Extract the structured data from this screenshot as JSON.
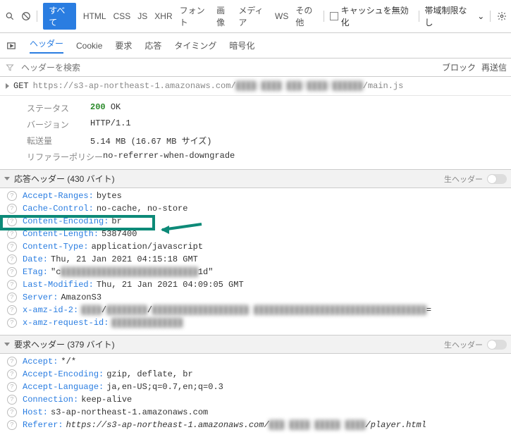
{
  "toolbar1": {
    "tabs": [
      "すべて",
      "HTML",
      "CSS",
      "JS",
      "XHR",
      "フォント",
      "画像",
      "メディア",
      "WS",
      "その他"
    ],
    "disableCache": "キャッシュを無効化",
    "throttling": "帯域制限なし"
  },
  "toolbar2": {
    "tabs": [
      "ヘッダー",
      "Cookie",
      "要求",
      "応答",
      "タイミング",
      "暗号化"
    ]
  },
  "toolbar3": {
    "searchPlaceholder": "ヘッダーを検索",
    "block": "ブロック",
    "resend": "再送信"
  },
  "request": {
    "method": "GET",
    "urlPrefix": "https://s3-ap-northeast-1.amazonaws.com/",
    "urlBlurred": "████-████ ███/████/██████",
    "urlSuffix": "/main.js"
  },
  "meta": {
    "statusLabel": "ステータス",
    "statusCode": "200",
    "statusText": "OK",
    "versionLabel": "バージョン",
    "version": "HTTP/1.1",
    "transferLabel": "転送量",
    "transfer": "5.14 MB (16.67 MB サイズ)",
    "referrerLabel": "リファラーポリシー",
    "referrer": "no-referrer-when-downgrade"
  },
  "response": {
    "sectionLabel": "応答ヘッダー (430 バイト)",
    "rawLabel": "生ヘッダー",
    "headers": [
      {
        "name": "Accept-Ranges",
        "value": "bytes"
      },
      {
        "name": "Cache-Control",
        "value": "no-cache, no-store"
      },
      {
        "name": "Content-Encoding",
        "value": "br"
      },
      {
        "name": "Content-Length",
        "value": "5387400"
      },
      {
        "name": "Content-Type",
        "value": "application/javascript"
      },
      {
        "name": "Date",
        "value": "Thu, 21 Jan 2021 04:15:18 GMT"
      },
      {
        "name": "ETag",
        "value": "\"c███████████████████████████1d\""
      },
      {
        "name": "Last-Modified",
        "value": "Thu, 21 Jan 2021 04:09:05 GMT"
      },
      {
        "name": "Server",
        "value": "AmazonS3"
      },
      {
        "name": "x-amz-id-2",
        "value": "████/████████/███████████████████ ██████████████████████████████████="
      },
      {
        "name": "x-amz-request-id",
        "value": "██████████████"
      }
    ]
  },
  "reqHeaders": {
    "sectionLabel": "要求ヘッダー (379 バイト)",
    "rawLabel": "生ヘッダー",
    "headers": [
      {
        "name": "Accept",
        "value": "*/*"
      },
      {
        "name": "Accept-Encoding",
        "value": "gzip, deflate, br"
      },
      {
        "name": "Accept-Language",
        "value": "ja,en-US;q=0.7,en;q=0.3"
      },
      {
        "name": "Connection",
        "value": "keep-alive"
      },
      {
        "name": "Host",
        "value": "s3-ap-northeast-1.amazonaws.com"
      },
      {
        "name": "Referer",
        "value": "https://s3-ap-northeast-1.amazonaws.com/███ ████ █████ ████/player.html",
        "italic": true
      }
    ]
  }
}
